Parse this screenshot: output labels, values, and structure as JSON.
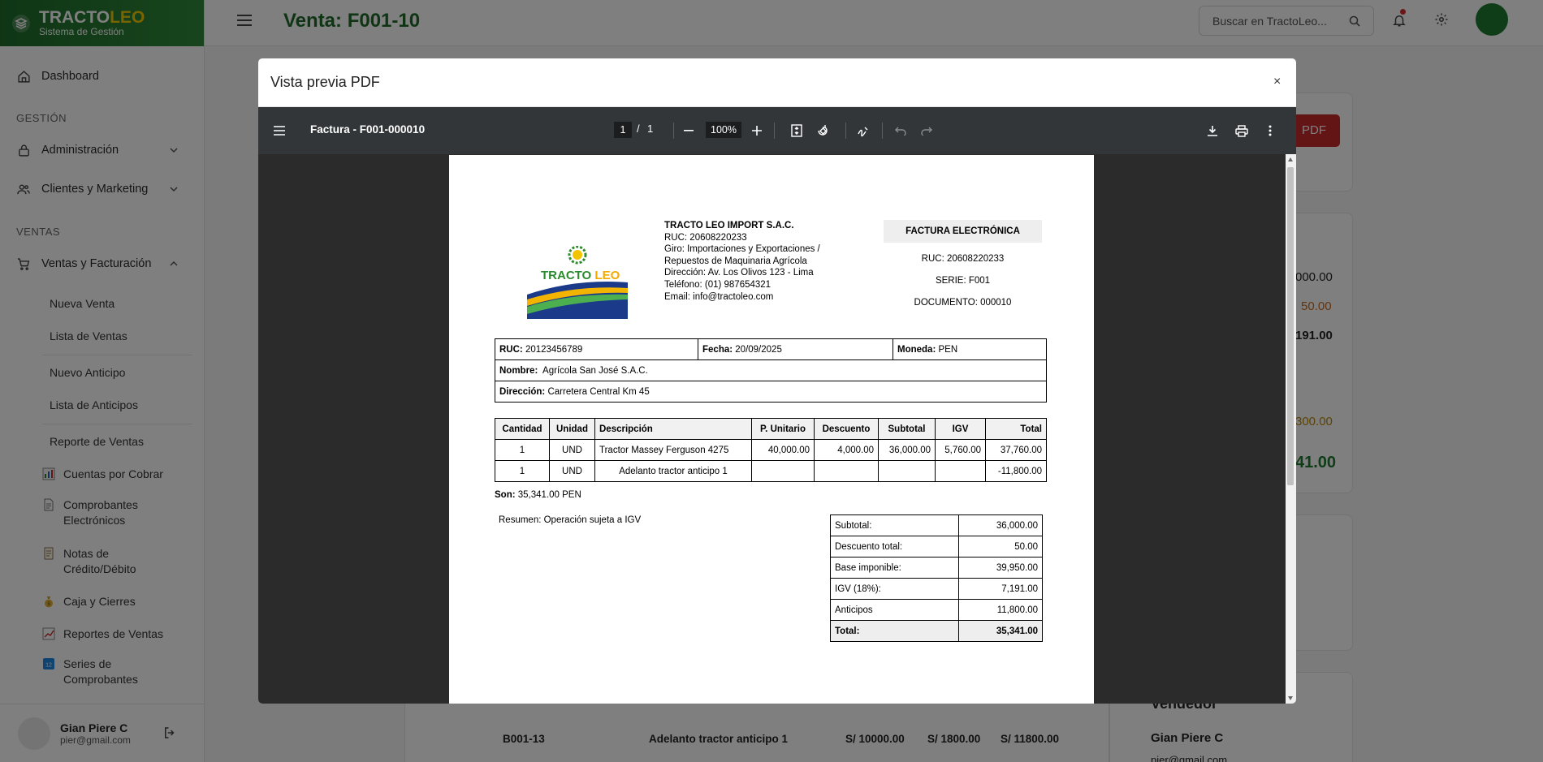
{
  "brand": {
    "name_part1": "TRACTO",
    "name_part2": "LEO",
    "subtitle": "Sistema de Gestión"
  },
  "sidebar": {
    "dashboard": "Dashboard",
    "section_gestion": "GESTIÓN",
    "administracion": "Administración",
    "clientes": "Clientes y Marketing",
    "section_ventas": "VENTAS",
    "ventas_facturacion": "Ventas y Facturación",
    "sub": [
      "Nueva Venta",
      "Lista de Ventas",
      "Nuevo Anticipo",
      "Lista de Anticipos",
      "Reporte de Ventas"
    ],
    "extra": [
      {
        "l1": "Cuentas por Cobrar",
        "l2": ""
      },
      {
        "l1": "Comprobantes",
        "l2": "Electrónicos"
      },
      {
        "l1": "Notas de",
        "l2": "Crédito/Débito"
      },
      {
        "l1": "Caja y Cierres",
        "l2": ""
      },
      {
        "l1": "Reportes de Ventas",
        "l2": ""
      },
      {
        "l1": "Series de",
        "l2": "Comprobantes"
      }
    ]
  },
  "user": {
    "name": "Gian Piere C",
    "email": "pier@gmail.com"
  },
  "header": {
    "title": "Venta: F001-10",
    "search_placeholder": "Buscar en TractoLeo..."
  },
  "background": {
    "pdf_btn": "PDF",
    "v1": "000.00",
    "v2": "50.00",
    "v3": "191.00",
    "v4": "300.00",
    "v5": "41.00",
    "vendedor": "Vendedor",
    "vendedor_name": "Gian Piere C",
    "vendedor_email": "pier@gmail.com",
    "row": [
      "B001-13",
      "Adelanto tractor anticipo 1",
      "S/ 10000.00",
      "S/ 1800.00",
      "S/ 11800.00"
    ]
  },
  "modal": {
    "title": "Vista previa PDF",
    "close": "×"
  },
  "viewer": {
    "doc_title": "Factura - F001-000010",
    "page": "1",
    "page_sep": "/",
    "page_total": "1",
    "zoom": "100%"
  },
  "invoice": {
    "logo_text1": "TRACTO",
    "logo_text2": " LEO",
    "company": "TRACTO LEO IMPORT S.A.C.",
    "ruc_line": "RUC: 20608220233",
    "giro_line": "Giro: Importaciones y Exportaciones / Repuestos de Maquinaria Agrícola",
    "dir_line": "Dirección: Av. Los Olivos 123 - Lima",
    "tel_line": "Teléfono: (01) 987654321",
    "email_line": "Email: info@tractoleo.com",
    "fact_title": "FACTURA ELECTRÓNICA",
    "fact_ruc": "RUC: 20608220233",
    "fact_serie": "SERIE: F001",
    "fact_doc": "DOCUMENTO: 000010",
    "client": {
      "ruc_label": "RUC:",
      "ruc": "20123456789",
      "fecha_label": "Fecha:",
      "fecha": "20/09/2025",
      "moneda_label": "Moneda:",
      "moneda": "PEN",
      "nombre_label": "Nombre:",
      "nombre": "Agrícola San José S.A.C.",
      "dir_label": "Dirección:",
      "direccion": "Carretera Central Km 45"
    },
    "headers": [
      "Cantidad",
      "Unidad",
      "Descripción",
      "P. Unitario",
      "Descuento",
      "Subtotal",
      "IGV",
      "Total"
    ],
    "rows": [
      [
        "1",
        "UND",
        "Tractor Massey Ferguson 4275",
        "40,000.00",
        "4,000.00",
        "36,000.00",
        "5,760.00",
        "37,760.00"
      ],
      [
        "1",
        "UND",
        "Adelanto tractor anticipo 1",
        "",
        "",
        "",
        "",
        "-11,800.00"
      ]
    ],
    "son_label": "Son:",
    "son": "35,341.00 PEN",
    "resumen": "Resumen: Operación sujeta a IGV",
    "totals": [
      {
        "label": "Subtotal:",
        "value": "36,000.00"
      },
      {
        "label": "Descuento total:",
        "value": "50.00"
      },
      {
        "label": "Base imponible:",
        "value": "39,950.00"
      },
      {
        "label": "IGV (18%):",
        "value": "7,191.00"
      },
      {
        "label": "Anticipos",
        "value": "11,800.00"
      },
      {
        "label": "Total:",
        "value": "35,341.00"
      }
    ]
  },
  "colors": {
    "brand_green": "#1e6b2b",
    "pdf_red": "#c62828",
    "bg_orange": "#c46a1c",
    "bg_gold": "#b8860b",
    "bg_green": "#1e7a2e"
  }
}
